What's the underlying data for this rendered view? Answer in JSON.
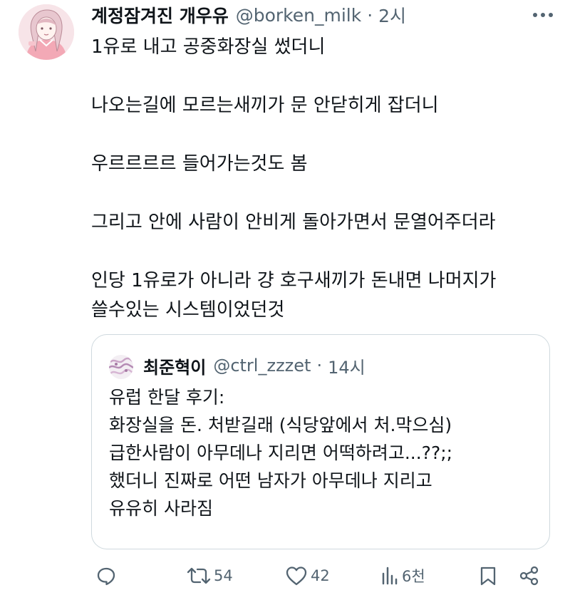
{
  "tweet": {
    "display_name": "계정잠겨진 개우유",
    "handle": "@borken_milk",
    "separator": "·",
    "time": "2시",
    "avatar_icon": "anime-girl-avatar",
    "lines": [
      "1유로 내고 공중화장실 썼더니",
      "",
      "나오는길에 모르는새끼가 문 안닫히게 잡더니",
      "",
      "우르르르르 들어가는것도 봄",
      "",
      "그리고 안에 사람이 안비게 돌아가면서 문열어주더라",
      "",
      "인당 1유로가 아니라 걍 호구새끼가 돈내면 나머지가",
      "쓸수있는 시스템이었던것"
    ]
  },
  "quote": {
    "display_name": "최준혁이",
    "handle": "@ctrl_zzzet",
    "separator": "·",
    "time": "14시",
    "avatar_icon": "pattern-avatar",
    "lines": [
      "유럽 한달 후기:",
      "화장실을 돈. 처받길래 (식당앞에서 처.막으심)",
      "급한사람이 아무데나 지리면 어떡하려고...??;;",
      "했더니 진짜로 어떤 남자가 아무데나 지리고",
      "유유히 사라짐"
    ]
  },
  "actions": {
    "reply_icon": "reply-icon",
    "retweet_count": "54",
    "like_count": "42",
    "views_count": "6천",
    "bookmark_icon": "bookmark-icon",
    "share_icon": "share-icon"
  },
  "colors": {
    "text": "#0f1419",
    "secondary": "#536471",
    "border": "#cfd9de"
  }
}
